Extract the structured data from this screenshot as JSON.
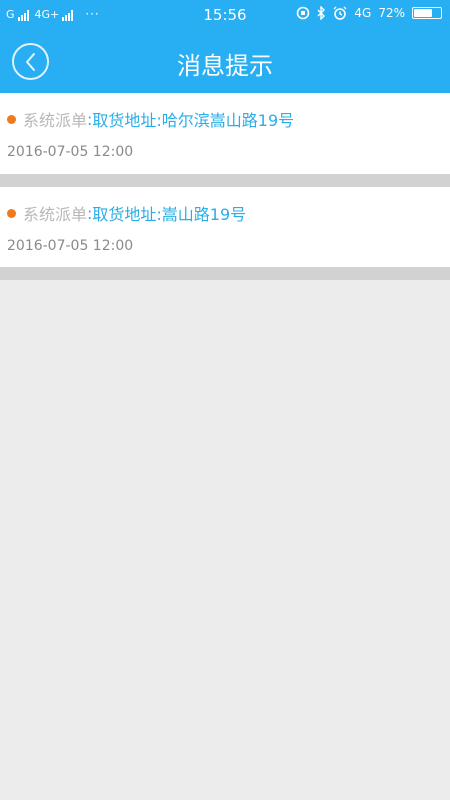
{
  "status_bar": {
    "carrier1": "G",
    "carrier2": "4G+",
    "dots": "···",
    "time": "15:56",
    "network": "4G",
    "battery_text": "72%",
    "battery_level": 0.72
  },
  "header": {
    "title": "消息提示",
    "bg_color": "#28aef2"
  },
  "messages": [
    {
      "category": "系统派单",
      "separator": ":",
      "address": "取货地址:哈尔滨嵩山路19号",
      "time": "2016-07-05 12:00"
    },
    {
      "category": "系统派单",
      "separator": ":",
      "address": "取货地址:嵩山路19号",
      "time": "2016-07-05 12:00"
    }
  ],
  "colors": {
    "accent": "#29aee8",
    "dot": "#f07a1f",
    "page_bg": "#ececec"
  },
  "icons": {
    "back": "chevron-left-icon"
  }
}
